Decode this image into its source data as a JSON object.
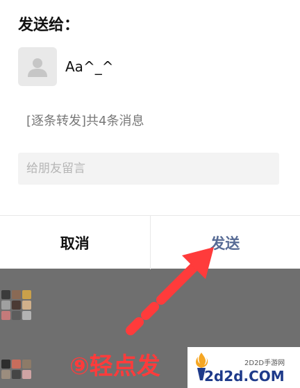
{
  "dialog": {
    "title": "发送给：",
    "recipient": {
      "name": "Aa^_^",
      "avatar_icon": "default-user-avatar-icon"
    },
    "message_summary": "[逐条转发]共4条消息",
    "comment": {
      "placeholder": "给朋友留言",
      "value": ""
    },
    "cancel_label": "取消",
    "send_label": "发送",
    "accent_color": "#576b95"
  },
  "annotation": {
    "step_text": "⑨轻点发",
    "arrow_color": "#ff3b3b"
  },
  "watermark": {
    "site_name": "2D2D手游网",
    "domain": "2d2d.COM"
  }
}
